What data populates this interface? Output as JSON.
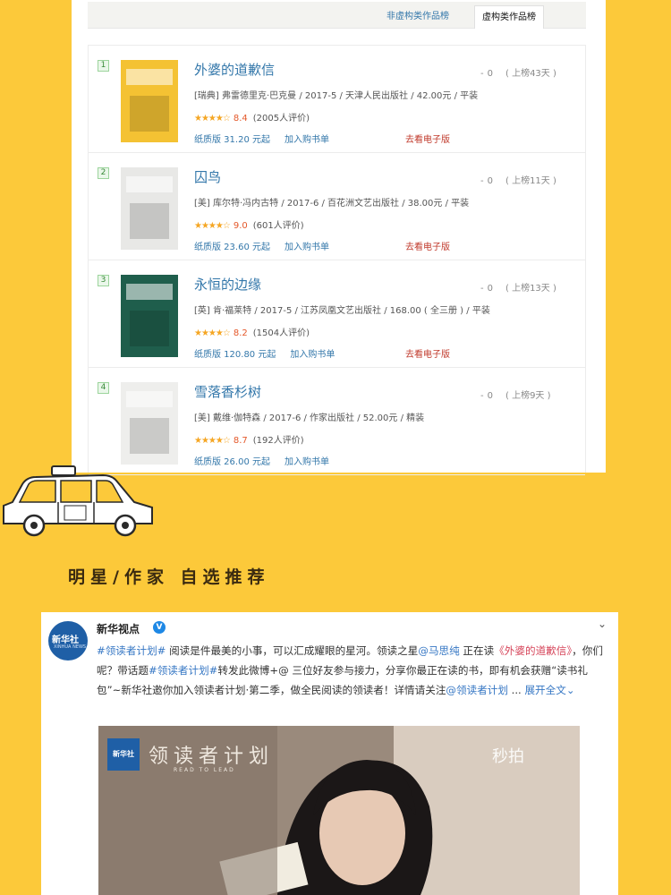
{
  "tabs": {
    "nonfiction": "非虚构类作品榜",
    "fiction": "虚构类作品榜"
  },
  "books": [
    {
      "rank": "1",
      "title": "外婆的道歉信",
      "meta": "[瑞典] 弗雷德里克·巴克曼 / 2017-5 / 天津人民出版社 / 42.00元 / 平装",
      "rating": 8.4,
      "score": "8.4",
      "votes": "(2005人评价)",
      "paper": "纸质版 31.20 元起",
      "cart": "加入购书单",
      "ebook": "去看电子版",
      "change": "0",
      "weeks": "( 上榜43天 )",
      "cover_color": "#f4c233"
    },
    {
      "rank": "2",
      "title": "囚鸟",
      "meta": "[美] 库尔特·冯内古特 / 2017-6 / 百花洲文艺出版社 / 38.00元 / 平装",
      "rating": 9.0,
      "score": "9.0",
      "votes": "(601人评价)",
      "paper": "纸质版 23.60 元起",
      "cart": "加入购书单",
      "ebook": "去看电子版",
      "change": "0",
      "weeks": "( 上榜11天 )",
      "cover_color": "#e8e8e6"
    },
    {
      "rank": "3",
      "title": "永恒的边缘",
      "meta": "[英] 肯·福莱特 / 2017-5 / 江苏凤凰文艺出版社 / 168.00 ( 全三册 ) / 平装",
      "rating": 8.2,
      "score": "8.2",
      "votes": "(1504人评价)",
      "paper": "纸质版 120.80 元起",
      "cart": "加入购书单",
      "ebook": "去看电子版",
      "change": "0",
      "weeks": "( 上榜13天 )",
      "cover_color": "#1f5e4c"
    },
    {
      "rank": "4",
      "title": "雪落香杉树",
      "meta": "[美] 戴维·伽特森 / 2017-6 / 作家出版社 / 52.00元 / 精装",
      "rating": 8.7,
      "score": "8.7",
      "votes": "(192人评价)",
      "paper": "纸质版 26.00 元起",
      "cart": "加入购书单",
      "ebook": "",
      "change": "0",
      "weeks": "( 上榜9天 )",
      "cover_color": "#eeeeec"
    }
  ],
  "section_title": "明星/作家 自选推荐",
  "weibo": {
    "user": "新华视点",
    "avatar_text": "新华社",
    "avatar_sub": "XINHUA NEWS",
    "post_parts": [
      {
        "t": "#领读者计划#",
        "c": "tag"
      },
      {
        "t": " 阅读是件最美的小事，可以汇成耀眼的星河。领读之星",
        "c": ""
      },
      {
        "t": "@马思纯",
        "c": "mention"
      },
      {
        "t": " 正在读",
        "c": ""
      },
      {
        "t": "《外婆的道歉信》",
        "c": "red"
      },
      {
        "t": "，你们呢？带话题",
        "c": ""
      },
      {
        "t": "#领读者计划#",
        "c": "tag"
      },
      {
        "t": "转发此微博+@ 三位好友参与接力，分享你最正在读的书，即有机会获赠“读书礼包”~新华社邀你加入领读者计划·第二季，做全民阅读的领读者！详情请关注",
        "c": ""
      },
      {
        "t": "@领读者计划",
        "c": "mention"
      },
      {
        "t": " ... ",
        "c": ""
      },
      {
        "t": "展开全文",
        "c": "mention"
      }
    ],
    "video_logo": "新华社",
    "video_brand": "领读者计划",
    "video_brand_sub": "READ TO LEAD",
    "video_mark": "秒拍"
  }
}
